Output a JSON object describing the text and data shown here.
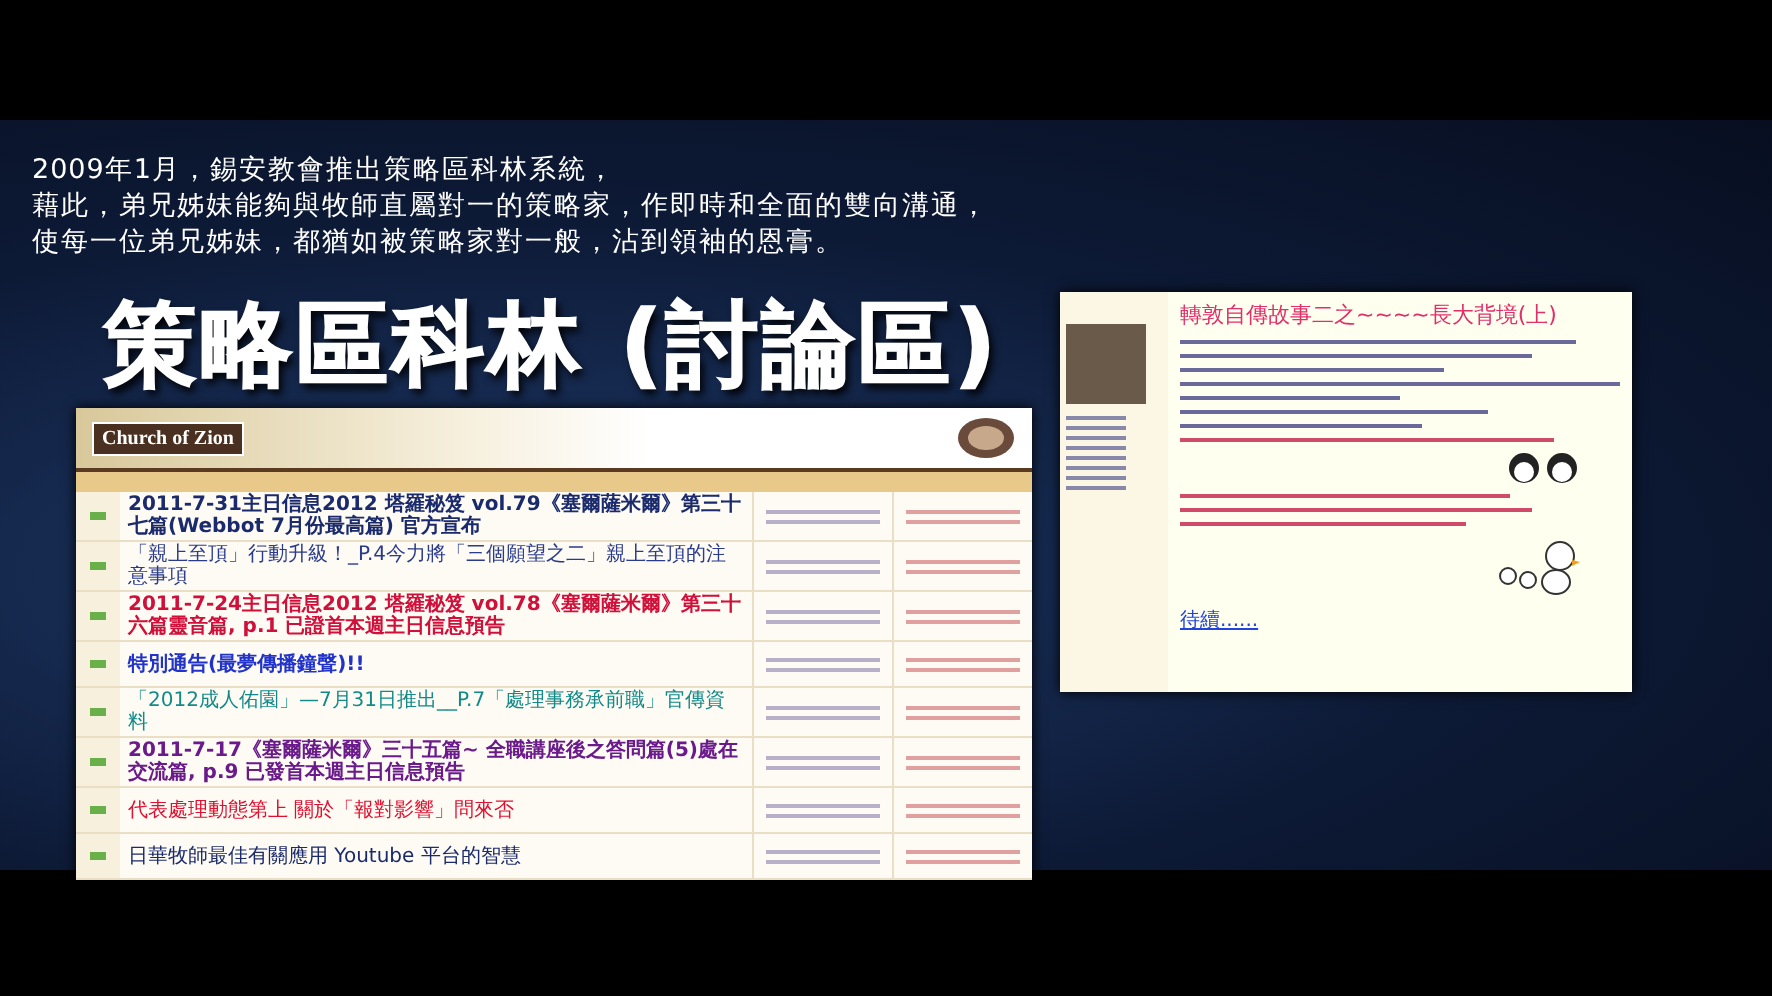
{
  "intro": {
    "lines": [
      "2009年1月，錫安教會推出策略區科林系統，",
      "藉此，弟兄姊妹能夠與牧師直屬對一的策略家，作即時和全面的雙向溝通，",
      "使每一位弟兄姊妹，都猶如被策略家對一般，沾到領袖的恩膏。"
    ]
  },
  "title": "策略區科林 (討論區)",
  "forum": {
    "logo": "Church of Zion",
    "threads": [
      {
        "title": "2011-7-31主日信息2012 塔羅秘笈 vol.79《塞爾薩米爾》第三十七篇(Webbot 7月份最高篇) 官方宣布",
        "color": "#1a2a6c",
        "bold": true
      },
      {
        "title": "「親上至頂」行動升級！_P.4今力將「三個願望之二」親上至頂的注意事項",
        "color": "#2a3a8c",
        "bold": false
      },
      {
        "title": "2011-7-24主日信息2012 塔羅秘笈 vol.78《塞爾薩米爾》第三十六篇靈音篇, p.1 已證首本週主日信息預告",
        "color": "#d0103a",
        "bold": true
      },
      {
        "title": "特別通告(最夢傳播鐘聲)!!",
        "color": "#2233cc",
        "bold": true
      },
      {
        "title": "「2012成人佑園」—7月31日推出__P.7「處理事務承前職」官傳資料",
        "color": "#138a8a",
        "bold": false
      },
      {
        "title": "2011-7-17《塞爾薩米爾》三十五篇~ 全職講座後之答問篇(5)處在交流篇, p.9 已發首本週主日信息預告",
        "color": "#6a1a8a",
        "bold": true
      },
      {
        "title": "代表處理動態第上 關於「報對影響」問來否",
        "color": "#e01030",
        "bold": false
      },
      {
        "title": "日華牧師最佳有關應用 Youtube 平台的智慧",
        "color": "#1a2a6c",
        "bold": false
      }
    ]
  },
  "post": {
    "title": "轉敦自傳故事二之~~~~長大背境(上)",
    "more_link": "待續......"
  }
}
